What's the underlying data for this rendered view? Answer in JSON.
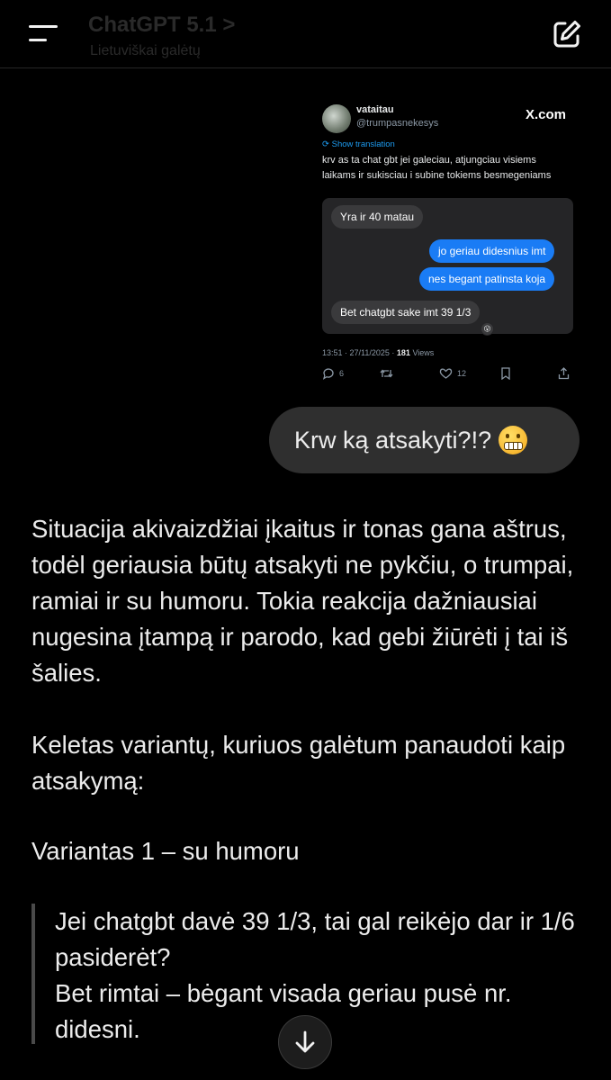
{
  "header": {
    "title": "ChatGPT 5.1 >",
    "subtitle": "Lietuviškai galėtų"
  },
  "tweet": {
    "username": "vataitau",
    "handle": "@trumpasnekesys",
    "source": "X.com",
    "show_translation": "Show translation",
    "text_line1": "krv as ta chat gbt jei galeciau, atjungciau visiems",
    "text_line2": "laikams ir sukisciau i subine tokiems besmegeniams",
    "chat_messages": [
      {
        "text": "Yra ir 40 matau",
        "side": "in"
      },
      {
        "text": "jo geriau didesnius imt",
        "side": "out"
      },
      {
        "text": "nes begant patinsta koja",
        "side": "out"
      },
      {
        "text": "Bet chatgbt sake imt 39 1/3",
        "side": "in"
      }
    ],
    "reaction": "😮",
    "meta_time": "13:51 · 27/11/2025 · ",
    "meta_views_count": "181",
    "meta_views_label": " Views",
    "reply_count": "6",
    "like_count": "12"
  },
  "user_message": {
    "text": "Krw ką atsakyti?!?"
  },
  "assistant": {
    "p1": "Situacija akivaizdžiai įkaitus ir tonas gana aštrus, todėl geriausia būtų atsakyti ne pykčiu, o trumpai, ramiai ir su humoru. Tokia reakcija dažniausiai nugesina įtampą ir parodo, kad gebi žiūrėti į tai iš šalies.",
    "p2": "Keletas variantų, kuriuos galėtum panaudoti kaip atsakymą:",
    "p3": "Variantas 1 – su humoru",
    "quote_line1": "Jei chatgbt davė 39 1/3, tai gal reikėjo dar ir 1/6 pasiderėt?",
    "quote_line2": "Bet rimtai – bėgant visada geriau pusė nr. didesni."
  },
  "colors": {
    "background": "#000000",
    "user_bubble": "#2f2f2f",
    "chat_out_bubble": "#1a7cf5",
    "link_blue": "#1d9bf0"
  }
}
